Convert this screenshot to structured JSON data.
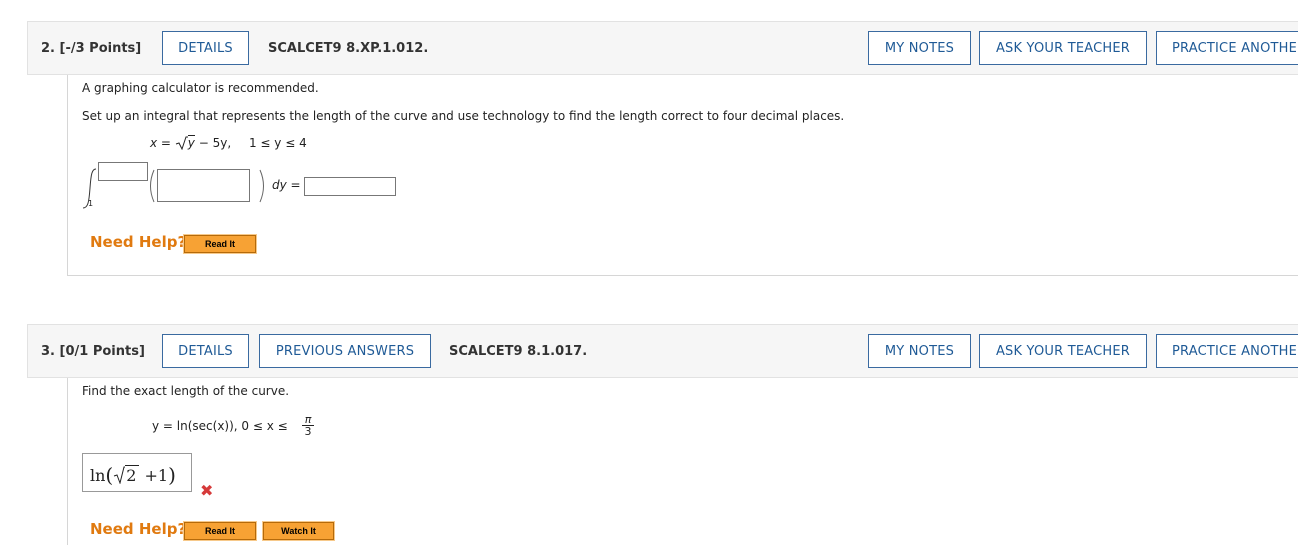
{
  "q2": {
    "number": "2.",
    "points": "[-/3 Points]",
    "details": "DETAILS",
    "code": "SCALCET9 8.XP.1.012.",
    "my_notes": "MY NOTES",
    "ask_teacher": "ASK YOUR TEACHER",
    "practice": "PRACTICE ANOTHER",
    "line1": "A graphing calculator is recommended.",
    "line2": "Set up an integral that represents the length of the curve and use technology to find the length correct to four decimal places.",
    "eq_lhs": "x",
    "eq_y": "y",
    "eq_rest": " − 5y,",
    "eq_range": "1 ≤ y ≤ 4",
    "lower_limit": "1",
    "dy_eq": "dy =",
    "upper_value": "",
    "integrand_value": "",
    "result_value": "",
    "need_help": "Need Help?",
    "read_it": "Read It"
  },
  "q3": {
    "number": "3.",
    "points": "[0/1 Points]",
    "details": "DETAILS",
    "previous": "PREVIOUS ANSWERS",
    "code": "SCALCET9 8.1.017.",
    "my_notes": "MY NOTES",
    "ask_teacher": "ASK YOUR TEACHER",
    "practice": "PRACTICE ANOTHER",
    "line1": "Find the exact length of the curve.",
    "eq": "y = ln(sec(x)),   0 ≤ x ≤",
    "pi": "π",
    "three": "3",
    "answer_ln": "ln",
    "answer_two": "2",
    "answer_plus": "+1",
    "need_help": "Need Help?",
    "read_it": "Read It",
    "watch_it": "Watch It"
  },
  "colors": {
    "link": "#1f5a96",
    "help": "#e07a10",
    "wrong": "#d63a3a",
    "button_orange": "#f7a234"
  }
}
